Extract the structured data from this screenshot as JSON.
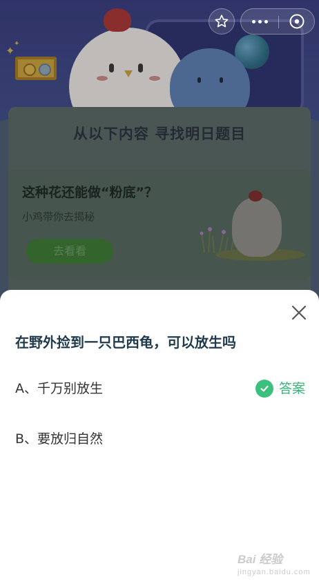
{
  "background_screen": {
    "quiz_title": "从以下内容 寻找明日题目",
    "article": {
      "title": "这种花还能做“粉底”？",
      "subtitle": "小鸡带你去揭秘",
      "button_label": "去看看"
    }
  },
  "top_controls": {
    "favorite_icon": "star-outline-icon",
    "more_icon": "more-dots-icon",
    "close_icon": "circle-x-icon"
  },
  "sheet": {
    "close_icon": "close-x-icon",
    "question": "在野外捡到一只巴西龟，可以放生吗",
    "options": [
      {
        "label": "A、千万别放生",
        "is_answer": true
      },
      {
        "label": "B、要放归自然",
        "is_answer": false
      }
    ],
    "answer_label": "答案"
  },
  "watermark": {
    "brand": "Bai 经验",
    "sub": "jingyan.baidu.com"
  },
  "colors": {
    "answer_green": "#3bb37a",
    "question_text": "#1f3a4d",
    "background_navy": "#3a3f7e"
  }
}
